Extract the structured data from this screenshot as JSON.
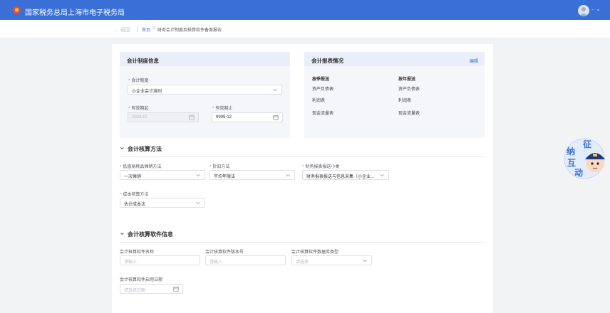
{
  "app": {
    "title": "国家税务总局上海市电子税务局",
    "user_menu_chevron": "·· ⌄"
  },
  "breadcrumb": {
    "back": "← 返回",
    "home": "首页",
    "separator": ">",
    "current": "财务会计制度及核算软件备案报告"
  },
  "accounting_system_card": {
    "title": "会计制度信息",
    "system_label": "会计制度",
    "system_value": "小企业会计准则",
    "valid_from_label": "有效期起",
    "valid_from_value": "2023-07",
    "valid_to_label": "有效期止",
    "valid_to_value": "9999-12"
  },
  "reports_card": {
    "title": "会计报表情况",
    "edit_label": "编辑",
    "columns": [
      {
        "header": "按季报送",
        "items": [
          "资产负债表",
          "利润表",
          "现金流量表"
        ]
      },
      {
        "header": "按年报送",
        "items": [
          "资产负债表",
          "利润表",
          "现金流量表"
        ]
      }
    ]
  },
  "method_section": {
    "title": "会计核算方法",
    "low_value_label": "低值易耗品摊销方法",
    "low_value_value": "一次摊销",
    "depreciation_label": "折旧方法",
    "depreciation_value": "平均年限法",
    "report_type_label": "财务报表报送小类",
    "report_type_value": "财务报表报送与信息采集（小企业...",
    "cost_label": "成本核算方法",
    "cost_value": "估计成本法"
  },
  "software_section": {
    "title": "会计核算软件信息",
    "name_label": "会计核算软件名称",
    "name_placeholder": "请输入",
    "version_label": "会计核算软件版本号",
    "version_placeholder": "请输入",
    "db_label": "会计核算软件数据库类型",
    "db_placeholder": "请选择",
    "date_label": "会计核算软件启用日期",
    "date_placeholder": "请选择日期"
  },
  "mascot": {
    "chars": [
      "征",
      "纳",
      "互",
      "动"
    ]
  },
  "colors": {
    "brand": "#3b6fd8",
    "required": "#f56c6c"
  }
}
